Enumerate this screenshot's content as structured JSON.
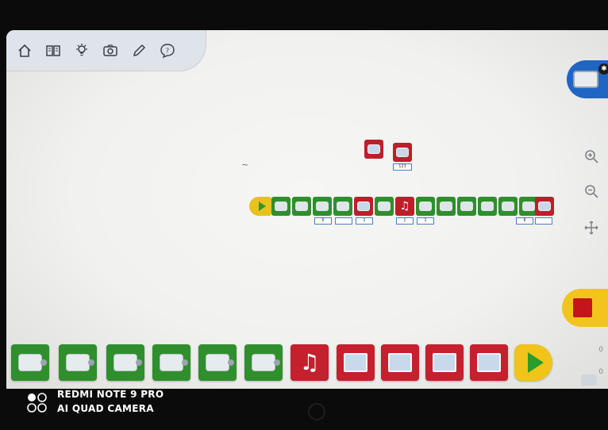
{
  "toolbar": {
    "buttons": [
      {
        "name": "home-icon",
        "glyph": "⌂"
      },
      {
        "name": "book-icon",
        "glyph": "📖"
      },
      {
        "name": "lightbulb-icon",
        "glyph": "💡"
      },
      {
        "name": "camera-icon",
        "glyph": "📷"
      },
      {
        "name": "pencil-icon",
        "glyph": "✎"
      },
      {
        "name": "help-icon",
        "glyph": "?"
      }
    ]
  },
  "canvas": {
    "stray_marker": "~",
    "chain_inputs": [
      "6",
      "",
      "1",
      "1",
      "1",
      "8",
      ""
    ],
    "floating_input": "123"
  },
  "palette": {
    "blocks": [
      {
        "name": "motor-speed-block",
        "kind": "motor"
      },
      {
        "name": "motor-wait-block",
        "kind": "motor"
      },
      {
        "name": "motor-stop-block",
        "kind": "motor"
      },
      {
        "name": "motor-counterclockwise-block",
        "kind": "motor"
      },
      {
        "name": "motor-clockwise-block",
        "kind": "motor"
      },
      {
        "name": "motor-power-block",
        "kind": "motor"
      },
      {
        "name": "sound-block",
        "kind": "sound",
        "glyph": "♫"
      },
      {
        "name": "display-image-block",
        "kind": "display"
      },
      {
        "name": "display-number-block",
        "kind": "display"
      },
      {
        "name": "display-add-block",
        "kind": "display"
      },
      {
        "name": "display-clear-block",
        "kind": "display"
      },
      {
        "name": "start-block",
        "kind": "flow"
      }
    ],
    "side_counts": [
      "0",
      "0"
    ]
  },
  "colors": {
    "motor_green": "#2f8f2d",
    "display_red": "#c4202d",
    "start_yellow": "#f0c419",
    "hub_blue": "#1f66c4",
    "stop_red": "#c4151c"
  },
  "camera_watermark": {
    "line1": "REDMI NOTE 9 PRO",
    "line2": "AI QUAD CAMERA"
  }
}
